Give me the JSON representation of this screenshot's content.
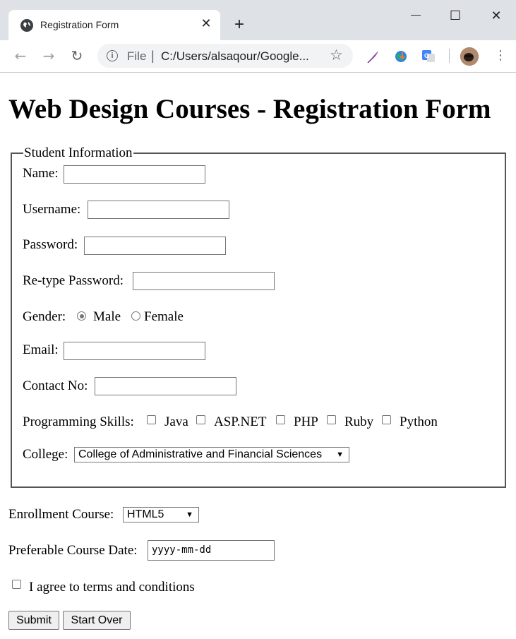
{
  "browser": {
    "tab_title": "Registration Form",
    "new_tab_label": "+",
    "tab_close_label": "✕",
    "window_controls": {
      "minimize": "—",
      "maximize": "☐",
      "close": "✕"
    },
    "nav": {
      "back": "←",
      "forward": "→",
      "reload": "↻"
    },
    "address": {
      "info_icon": "i",
      "scheme_label": "File",
      "separator": "|",
      "url": "C:/Users/alsaqour/Google..."
    },
    "bookmark_icon": "☆",
    "extensions": [
      "quill-icon",
      "globe-download-icon",
      "google-translate-icon",
      "profile-avatar"
    ]
  },
  "page": {
    "title": "Web Design Courses - Registration Form",
    "fieldset": {
      "legend": "Student Information",
      "name_label": "Name:",
      "username_label": "Username:",
      "password_label": "Password:",
      "retype_label": "Re-type Password:",
      "gender_label": "Gender:",
      "gender_options": [
        "Male",
        "Female"
      ],
      "gender_selected": "Male",
      "email_label": "Email:",
      "contact_label": "Contact No:",
      "skills_label": "Programming Skills:",
      "skills": [
        "Java",
        "ASP.NET",
        "PHP",
        "Ruby",
        "Python"
      ],
      "college_label": "College:",
      "college_value": "College of Administrative and Financial Sciences"
    },
    "enrollment_label": "Enrollment Course:",
    "enrollment_value": "HTML5",
    "date_label": "Preferable Course Date:",
    "date_placeholder": "yyyy-mm-dd",
    "agree_label": "I agree to terms and conditions",
    "submit_label": "Submit",
    "reset_label": "Start Over"
  }
}
